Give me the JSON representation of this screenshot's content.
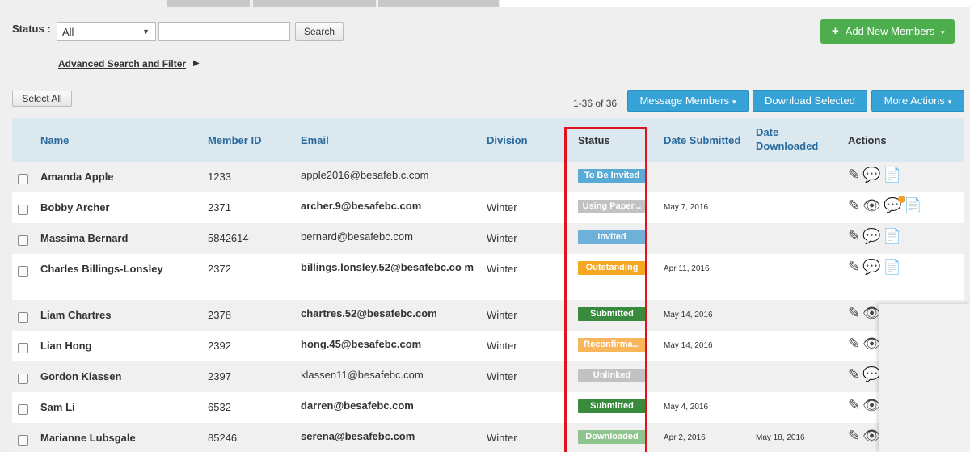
{
  "toolbar": {
    "status_label": "Status :",
    "status_value": "All",
    "search_value": "",
    "search_button": "Search",
    "add_button": "Add New Members",
    "advanced_link": "Advanced Search and Filter"
  },
  "list_toolbar": {
    "select_all": "Select All",
    "count": "1-36 of 36",
    "message_members": "Message Members",
    "download_selected": "Download Selected",
    "more_actions": "More Actions"
  },
  "table": {
    "headers": {
      "name": "Name",
      "member_id": "Member ID",
      "email": "Email",
      "division": "Division",
      "status": "Status",
      "date_submitted": "Date Submitted",
      "date_downloaded_1": "Date",
      "date_downloaded_2": "Downloaded",
      "actions": "Actions"
    },
    "rows": [
      {
        "name": "Amanda Apple",
        "id": "1233",
        "email": "apple2016@besafeb.c.com",
        "email_bold": false,
        "division": "",
        "status": "To Be Invited",
        "status_color": "#5aaad6",
        "submitted": "",
        "downloaded": ""
      },
      {
        "name": "Bobby Archer",
        "id": "2371",
        "email": "archer.9@besafebc.com",
        "email_bold": true,
        "division": "Winter",
        "status": "Using Paper...",
        "status_color": "#c2c2c2",
        "submitted": "May 7, 2016",
        "downloaded": ""
      },
      {
        "name": "Massima Bernard",
        "id": "5842614",
        "email": "bernard@besafebc.com",
        "email_bold": false,
        "division": "Winter",
        "status": "Invited",
        "status_color": "#6fb0d8",
        "submitted": "",
        "downloaded": ""
      },
      {
        "name": "Charles Billings-Lonsley",
        "id": "2372",
        "email": "billings.lonsley.52@besafebc.co m",
        "email_bold": true,
        "division": "Winter",
        "status": "Outstanding",
        "status_color": "#f5a623",
        "submitted": "Apr 11, 2016",
        "downloaded": ""
      },
      {
        "name": "Liam Chartres",
        "id": "2378",
        "email": "chartres.52@besafebc.com",
        "email_bold": true,
        "division": "Winter",
        "status": "Submitted",
        "status_color": "#3a8a3e",
        "submitted": "May 14, 2016",
        "downloaded": ""
      },
      {
        "name": "Lian Hong",
        "id": "2392",
        "email": "hong.45@besafebc.com",
        "email_bold": true,
        "division": "Winter",
        "status": "Reconfirma...",
        "status_color": "#f7b65a",
        "submitted": "May 14, 2016",
        "downloaded": ""
      },
      {
        "name": "Gordon Klassen",
        "id": "2397",
        "email": "klassen11@besafebc.com",
        "email_bold": false,
        "division": "Winter",
        "status": "Unlinked",
        "status_color": "#c2c2c2",
        "submitted": "",
        "downloaded": ""
      },
      {
        "name": "Sam Li",
        "id": "6532",
        "email": "darren@besafebc.com",
        "email_bold": true,
        "division": "",
        "status": "Submitted",
        "status_color": "#3a8a3e",
        "submitted": "May 4, 2016",
        "downloaded": ""
      },
      {
        "name": "Marianne Lubsgale",
        "id": "85246",
        "email": "serena@besafebc.com",
        "email_bold": true,
        "division": "Winter",
        "status": "Downloaded",
        "status_color": "#8fc48f",
        "submitted": "Apr 2, 2016",
        "downloaded": "May 18, 2016"
      }
    ],
    "row_actions": [
      [
        "edit-icon",
        "comment-add-icon",
        "document-add-icon"
      ],
      [
        "edit-icon",
        "view-icon",
        "comment-notification-icon",
        "document-add-icon"
      ],
      [
        "edit-icon",
        "comment-add-icon",
        "document-add-icon"
      ],
      [
        "edit-icon",
        "comment-add-icon",
        "document-add-icon"
      ],
      [
        "edit-icon",
        "view-icon"
      ],
      [
        "edit-icon",
        "view-icon"
      ],
      [
        "edit-icon",
        "comment-add-icon"
      ],
      [
        "edit-icon",
        "view-icon"
      ],
      [
        "edit-icon",
        "view-icon"
      ]
    ]
  },
  "colors": {
    "accent_blue": "#36a2d6",
    "add_green": "#4cae4c",
    "header_bg": "#dbe8f0",
    "highlight_red": "#e0141e"
  }
}
